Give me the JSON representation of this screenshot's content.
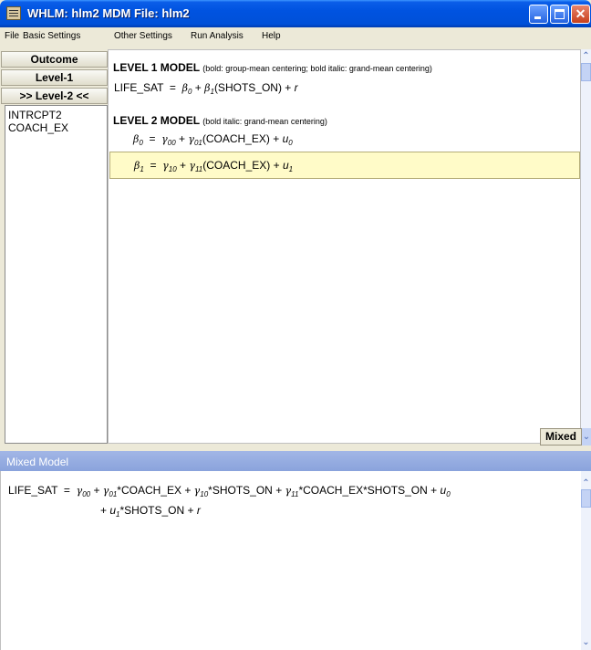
{
  "window": {
    "title": "WHLM: hlm2 MDM File: hlm2"
  },
  "menu": {
    "items": [
      "File",
      "Basic Settings",
      "Other Settings",
      "Run Analysis",
      "Help"
    ]
  },
  "sidebar": {
    "buttons": [
      "Outcome",
      "Level-1",
      ">> Level-2 <<"
    ],
    "variables": [
      "INTRCPT2",
      "COACH_EX"
    ]
  },
  "level1": {
    "heading": "LEVEL 1 MODEL",
    "note": "(bold: group-mean centering; bold italic: grand-mean centering)",
    "eq": {
      "lhs": "LIFE_SAT",
      "eqsign": "=",
      "b0": "β",
      "b0_sub": "0",
      "plus1": "+",
      "b1": "β",
      "b1_sub": "1",
      "pred": "(SHOTS_ON)",
      "plus2": "+",
      "r": "r"
    }
  },
  "level2": {
    "heading": "LEVEL 2 MODEL",
    "note": "(bold italic: grand-mean centering)",
    "eq0": {
      "lhs": "β",
      "lhs_sub": "0",
      "eqsign": "=",
      "g00": "γ",
      "g00_sub": "00",
      "plus1": "+",
      "g01": "γ",
      "g01_sub": "01",
      "pred": "(COACH_EX)",
      "plus2": "+",
      "u": "u",
      "u_sub": "0"
    },
    "eq1": {
      "lhs": "β",
      "lhs_sub": "1",
      "eqsign": "=",
      "g10": "γ",
      "g10_sub": "10",
      "plus1": "+",
      "g11": "γ",
      "g11_sub": "11",
      "pred": "(COACH_EX)",
      "plus2": "+",
      "u": "u",
      "u_sub": "1"
    }
  },
  "mixed_toggle": {
    "label": "Mixed"
  },
  "mixed": {
    "header": "Mixed Model",
    "line1": {
      "lhs": "LIFE_SAT",
      "eqsign": "=",
      "g00": "γ",
      "g00_sub": "00",
      "p1": "+",
      "g01": "γ",
      "g01_sub": "01",
      "t1": "*COACH_EX",
      "p2": "+",
      "g10": "γ",
      "g10_sub": "10",
      "t2": "*SHOTS_ON",
      "p3": "+",
      "g11": "γ",
      "g11_sub": "11",
      "t3": "*COACH_EX*SHOTS_ON",
      "p4": "+",
      "u": "u",
      "u_sub": "0"
    },
    "line2": {
      "p1": "+",
      "u": "u",
      "u_sub": "1",
      "t1": "*SHOTS_ON",
      "p2": "+",
      "r": "r"
    }
  },
  "colors": {
    "titlebar": "#0053e0",
    "highlight_row": "#fffbc8",
    "mixed_header": "#8aa3dc"
  },
  "icons": [
    "app-icon",
    "minimize-icon",
    "maximize-icon",
    "close-icon",
    "scroll-up-arrow-icon",
    "scroll-down-arrow-icon"
  ]
}
